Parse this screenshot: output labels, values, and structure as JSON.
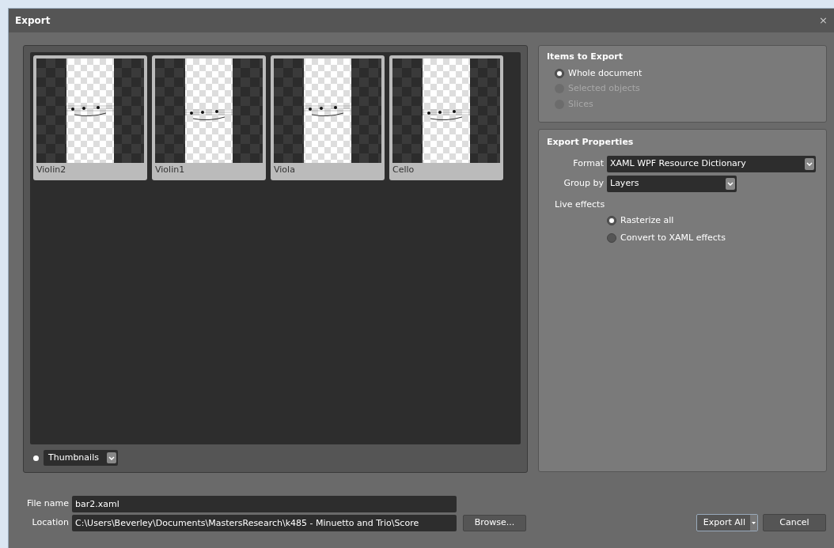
{
  "window": {
    "title": "Export",
    "close": "×"
  },
  "thumbnails": [
    {
      "label": "Violin2",
      "selected": false
    },
    {
      "label": "Violin1",
      "selected": false
    },
    {
      "label": "Viola",
      "selected": false
    },
    {
      "label": "Cello",
      "selected": false
    }
  ],
  "view_mode": {
    "value": "Thumbnails"
  },
  "items_to_export": {
    "title": "Items to Export",
    "options": [
      {
        "label": "Whole document",
        "selected": true,
        "disabled": false
      },
      {
        "label": "Selected objects",
        "selected": false,
        "disabled": true
      },
      {
        "label": "Slices",
        "selected": false,
        "disabled": true
      }
    ]
  },
  "export_properties": {
    "title": "Export Properties",
    "format": {
      "label": "Format",
      "value": "XAML WPF Resource Dictionary"
    },
    "group_by": {
      "label": "Group by",
      "value": "Layers"
    },
    "live_effects": {
      "label": "Live effects",
      "options": [
        {
          "label": "Rasterize all",
          "selected": true
        },
        {
          "label": "Convert to XAML effects",
          "selected": false
        }
      ]
    }
  },
  "file_name": {
    "label": "File name",
    "value": "bar2.xaml"
  },
  "location": {
    "label": "Location",
    "value": "C:\\Users\\Beverley\\Documents\\MastersResearch\\k485 - Minuetto and Trio\\Score"
  },
  "buttons": {
    "browse": "Browse...",
    "export": "Export All",
    "cancel": "Cancel"
  }
}
